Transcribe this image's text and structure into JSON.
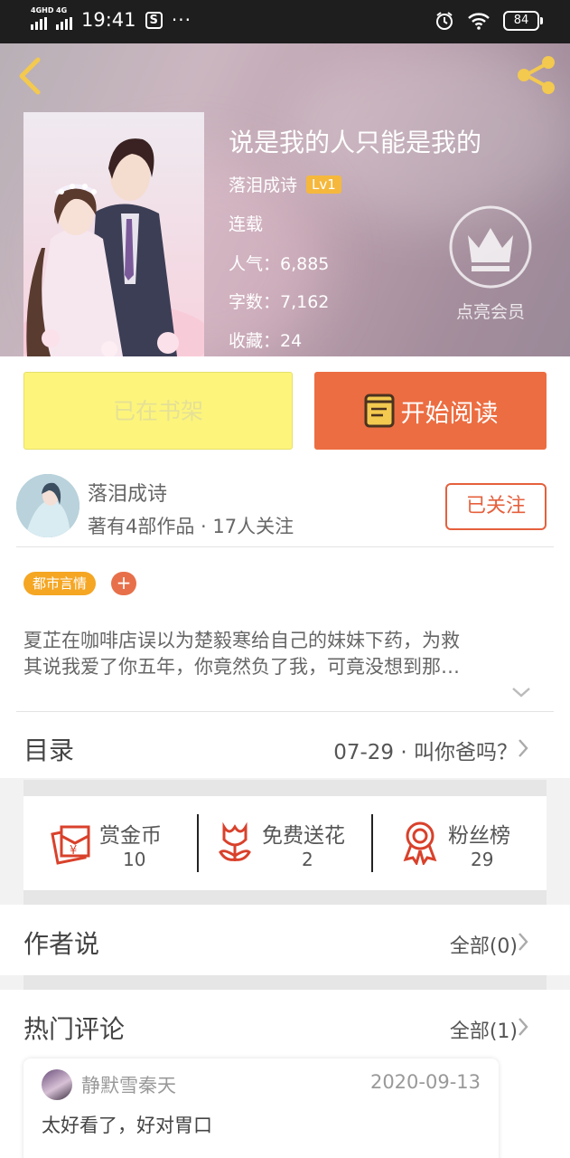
{
  "status_bar": {
    "network_1": "4GHD",
    "network_2": "4G",
    "time": "19:41",
    "dots": "···",
    "battery": "84",
    "icons": [
      "signal-icon",
      "alarm-icon",
      "wifi-icon",
      "battery-icon"
    ]
  },
  "book": {
    "title": "说是我的人只能是我的",
    "author": "落泪成诗",
    "level": "Lv1",
    "status": "连载",
    "popularity": "人气：6,885",
    "word_count": "字数：7,162",
    "favorites": "收藏：24",
    "vip_label": "点亮会员"
  },
  "actions": {
    "shelf_label": "已在书架",
    "read_label": "开始阅读"
  },
  "author_card": {
    "name": "落泪成诗",
    "stats": "著有4部作品 · 17人关注",
    "follow_label": "已关注"
  },
  "tags": {
    "genre": "都市言情",
    "add": "+"
  },
  "description": {
    "line1": "夏芷在咖啡店误以为楚毅寒给自己的妹妹下药，为救",
    "line2": "其说我爱了你五年，你竟然负了我，可竟没想到那…"
  },
  "toc": {
    "label": "目录",
    "latest": "07-29 · 叫你爸吗？"
  },
  "rewards": [
    {
      "label": "赏金币",
      "value": "10",
      "icon": "coin-icon"
    },
    {
      "label": "免费送花",
      "value": "2",
      "icon": "flower-icon"
    },
    {
      "label": "粉丝榜",
      "value": "29",
      "icon": "medal-icon"
    }
  ],
  "author_says": {
    "title": "作者说",
    "link": "全部(0)"
  },
  "hot_comments": {
    "title": "热门评论",
    "link": "全部(1)",
    "items": [
      {
        "user": "静默雪秦天",
        "date": "2020-09-13",
        "text": "太好看了，好对胃口"
      }
    ]
  },
  "colors": {
    "accent": "#ec6d41",
    "shelf": "#fdf57b",
    "tag": "#f5a623",
    "icon_red": "#d9412b"
  }
}
